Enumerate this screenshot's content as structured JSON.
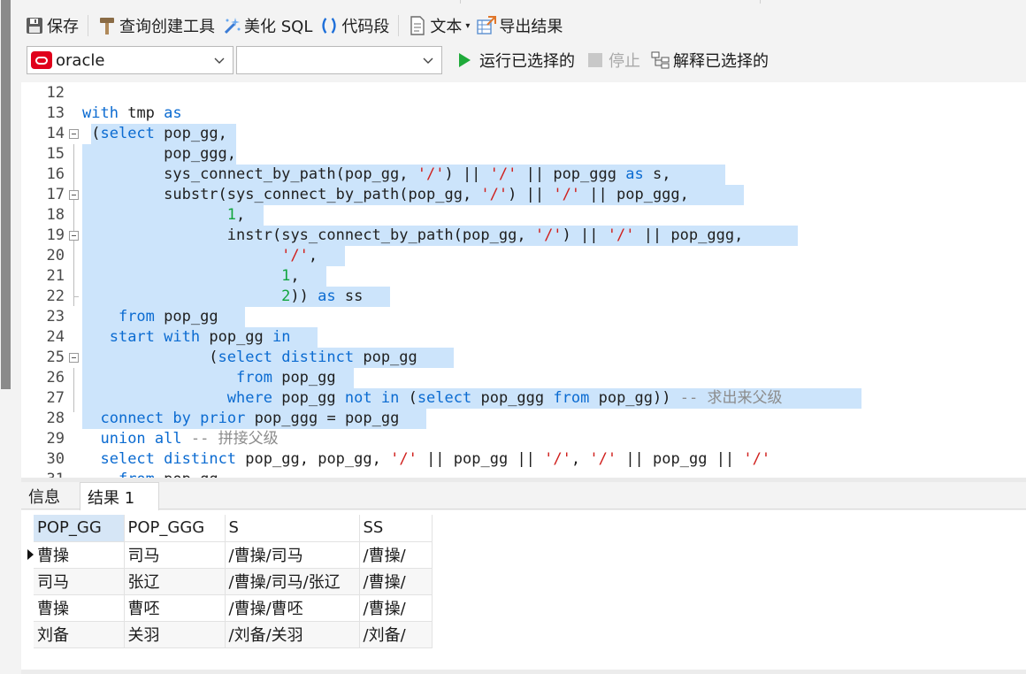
{
  "toolbar": {
    "save_label": "保存",
    "query_builder_label": "查询创建工具",
    "beautify_sql_label": "美化 SQL",
    "code_snippet_label": "代码段",
    "text_label": "文本",
    "export_label": "导出结果"
  },
  "toolbar2": {
    "connection_value": "oracle",
    "schema_value": "",
    "run_selected_label": "运行已选择的",
    "stop_label": "停止",
    "explain_selected_label": "解释已选择的"
  },
  "editor": {
    "lines": [
      {
        "n": "12",
        "text": ""
      },
      {
        "n": "13",
        "text": "with tmp as"
      },
      {
        "n": "14",
        "text": " (select pop_gg,"
      },
      {
        "n": "15",
        "text": "         pop_ggg,"
      },
      {
        "n": "16",
        "text": "         sys_connect_by_path(pop_gg, '/') || '/' || pop_ggg as s,"
      },
      {
        "n": "17",
        "text": "         substr(sys_connect_by_path(pop_gg, '/') || '/' || pop_ggg,"
      },
      {
        "n": "18",
        "text": "                1,"
      },
      {
        "n": "19",
        "text": "                instr(sys_connect_by_path(pop_gg, '/') || '/' || pop_ggg,"
      },
      {
        "n": "20",
        "text": "                      '/',"
      },
      {
        "n": "21",
        "text": "                      1,"
      },
      {
        "n": "22",
        "text": "                      2)) as ss"
      },
      {
        "n": "23",
        "text": "    from pop_gg"
      },
      {
        "n": "24",
        "text": "   start with pop_gg in"
      },
      {
        "n": "25",
        "text": "              (select distinct pop_gg"
      },
      {
        "n": "26",
        "text": "                 from pop_gg"
      },
      {
        "n": "27",
        "text": "                where pop_gg not in (select pop_ggg from pop_gg)) -- 求出来父级"
      },
      {
        "n": "28",
        "text": "  connect by prior pop_ggg = pop_gg"
      },
      {
        "n": "29",
        "text": "  union all -- 拼接父级"
      },
      {
        "n": "30",
        "text": "  select distinct pop_gg, pop_gg, '/' || pop_gg || '/', '/' || pop_gg || '/'"
      },
      {
        "n": "31",
        "text": "    from pop_gg"
      }
    ]
  },
  "tabs": {
    "info_label": "信息",
    "result_label": "结果 1"
  },
  "result": {
    "columns": [
      "POP_GG",
      "POP_GGG",
      "S",
      "SS"
    ],
    "rows": [
      [
        "曹操",
        "司马",
        "/曹操/司马",
        "/曹操/"
      ],
      [
        "司马",
        "张辽",
        "/曹操/司马/张辽",
        "/曹操/"
      ],
      [
        "曹操",
        "曹呸",
        "/曹操/曹呸",
        "/曹操/"
      ],
      [
        "刘备",
        "关羽",
        "/刘备/关羽",
        "/刘备/"
      ]
    ]
  },
  "icons": {
    "save": "save-icon",
    "query_builder": "hammer-icon",
    "beautify": "magic-wand-icon",
    "snippet": "brackets-icon",
    "text": "document-icon",
    "export": "export-table-icon",
    "run": "play-icon",
    "stop": "stop-icon",
    "explain": "explain-tree-icon"
  },
  "colors": {
    "keyword": "#0b6bd1",
    "string": "#d0201d",
    "number": "#11a53e",
    "comment": "#8c8c8c",
    "selection": "#cce4fb",
    "run_green": "#1faa3a",
    "oracle_red": "#e0001b"
  }
}
